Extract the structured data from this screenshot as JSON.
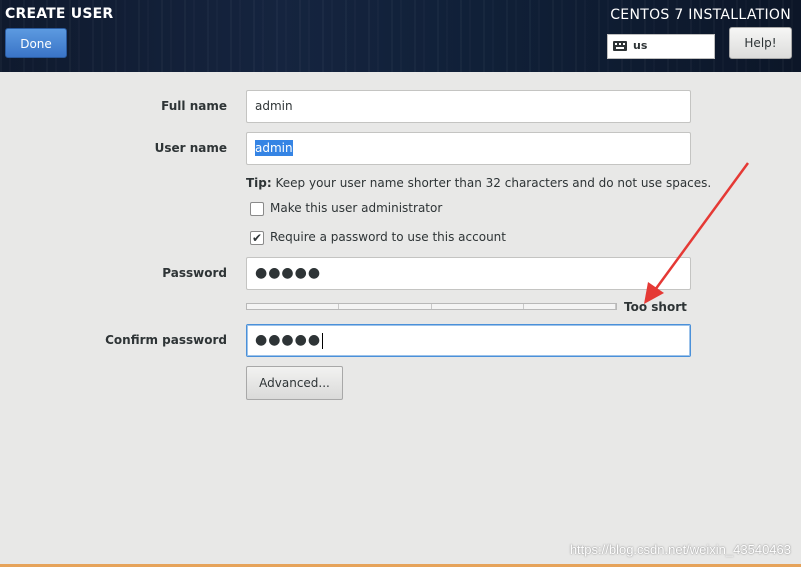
{
  "header": {
    "title": "CREATE USER",
    "done_label": "Done",
    "installer_title": "CENTOS 7 INSTALLATION",
    "keyboard_layout": "us",
    "help_label": "Help!"
  },
  "form": {
    "full_name": {
      "label": "Full name",
      "value": "admin"
    },
    "user_name": {
      "label": "User name",
      "value": "admin"
    },
    "tip": {
      "prefix": "Tip:",
      "text": " Keep your user name shorter than 32 characters and do not use spaces."
    },
    "admin_checkbox": {
      "label": "Make this user administrator",
      "checked": false
    },
    "require_password_checkbox": {
      "label": "Require a password to use this account",
      "checked": true
    },
    "password": {
      "label": "Password",
      "masked_value": "●●●●●"
    },
    "strength": {
      "text": "Too short",
      "level": 0
    },
    "confirm_password": {
      "label": "Confirm password",
      "masked_value": "●●●●●"
    },
    "advanced_label": "Advanced..."
  },
  "colors": {
    "accent": "#3a74c7",
    "header_bg": "#15243f",
    "annotation_arrow": "#e53935",
    "check_mark": "✔"
  },
  "watermark": "https://blog.csdn.net/weixin_43540463"
}
